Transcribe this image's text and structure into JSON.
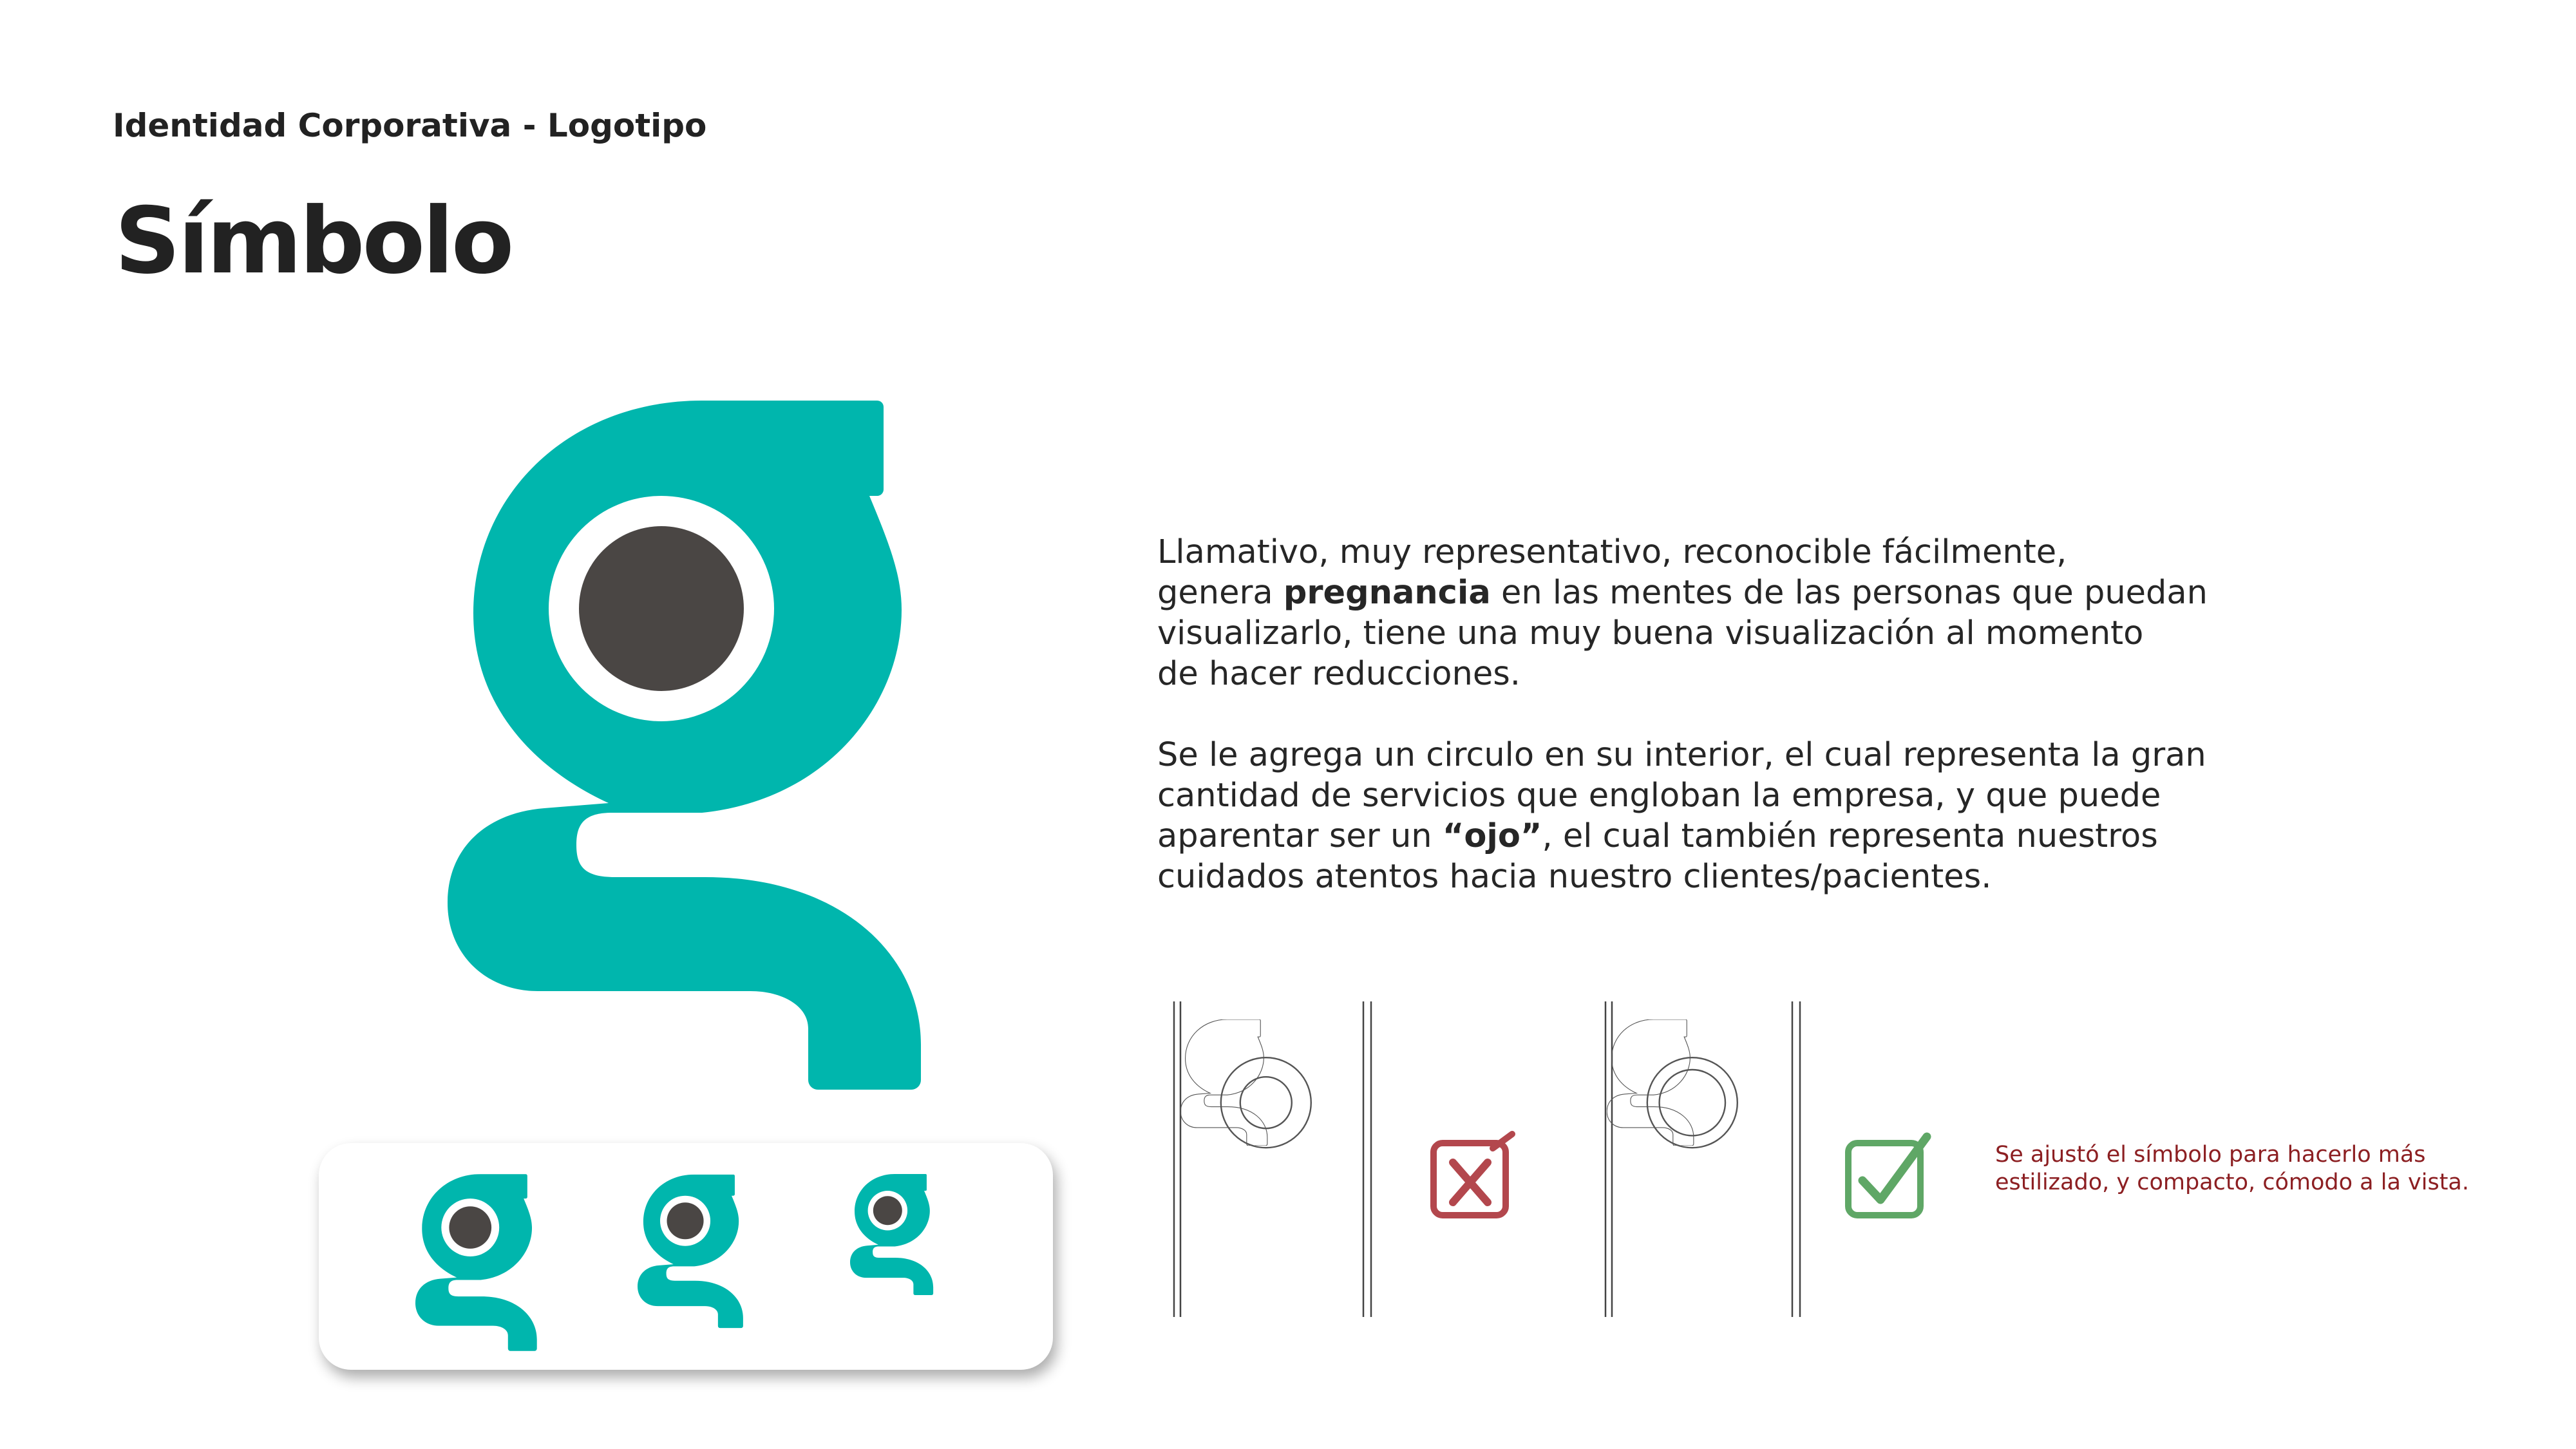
{
  "header": {
    "subtitle": "Identidad Corporativa - Logotipo",
    "title": "Símbolo"
  },
  "description": {
    "paragraph1_before": "Llamativo, muy representativo, reconocible fácilmente,\ngenera ",
    "paragraph1_bold": "pregnancia",
    "paragraph1_after": " en las mentes de las personas que puedan\nvisualizarlo, tiene una muy buena visualización al momento\nde hacer reducciones.",
    "paragraph2_before": "Se le agrega un circulo en su interior, el cual representa la gran\ncantidad de servicios que engloban la empresa, y que puede\naparentar ser un ",
    "paragraph2_bold": "“ojo”",
    "paragraph2_after": ", el cual también representa nuestros\ncuidados atentos hacia nuestro clientes/pacientes."
  },
  "comparison": {
    "note": "Se ajustó el símbolo para hacerlo más\nestilizado, y compacto, cómodo a la vista.",
    "rejected_icon": "x-mark-icon",
    "approved_icon": "check-mark-icon"
  },
  "colors": {
    "brand_teal": "#00b6ad",
    "eye_dark": "#4a4644",
    "reject_red": "#b3474d",
    "approve_green": "#5fa766",
    "note_text": "#8c1f22"
  }
}
